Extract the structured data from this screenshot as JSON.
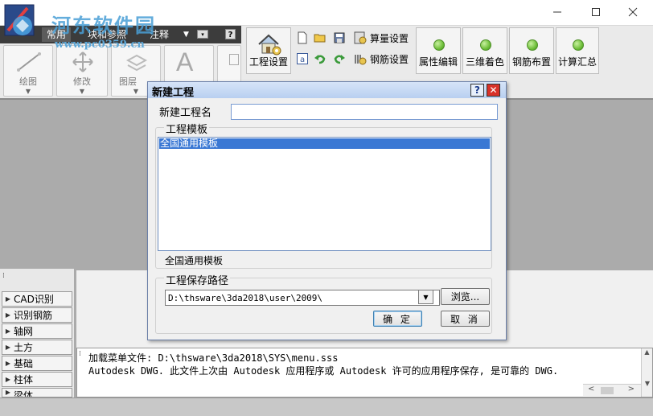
{
  "watermark": {
    "site_name": "河东软件园",
    "site_url": "www.pc0359.cn"
  },
  "ribbon": {
    "tabs": [
      "常用",
      "块和参照",
      "注释"
    ],
    "panels": [
      {
        "label": "绘图"
      },
      {
        "label": "修改"
      },
      {
        "label": "图层"
      }
    ],
    "project_settings": "工程设置",
    "calc_settings": "算量设置",
    "rebar_settings": "钢筋设置",
    "big_buttons": [
      "属性编辑",
      "三维着色",
      "钢筋布置",
      "计算汇总"
    ]
  },
  "left_dock": {
    "items": [
      "CAD识别",
      "识别钢筋",
      "轴网",
      "土方",
      "基础",
      "柱体",
      "梁体"
    ]
  },
  "command": {
    "lines": [
      "加载菜单文件: D:\\thsware\\3da2018\\SYS\\menu.sss",
      "Autodesk DWG.  此文件上次由 Autodesk 应用程序或 Autodesk 许可的应用程序保存, 是可靠的 DWG."
    ]
  },
  "dialog": {
    "title": "新建工程",
    "help_label": "?",
    "close_label": "✕",
    "name_label": "新建工程名",
    "name_value": "",
    "template_group_label": "工程模板",
    "template_list": [
      "全国通用模板"
    ],
    "selected_template": "全国通用模板",
    "save_path_group_label": "工程保存路径",
    "save_path_value": "D:\\thsware\\3da2018\\user\\2009\\",
    "browse_label": "浏览...",
    "ok_label": "确 定",
    "cancel_label": "取 消"
  },
  "colors": {
    "selection": "#3a78d4",
    "canvas": "#ababab",
    "title_gradient_start": "#d6e4f8"
  }
}
